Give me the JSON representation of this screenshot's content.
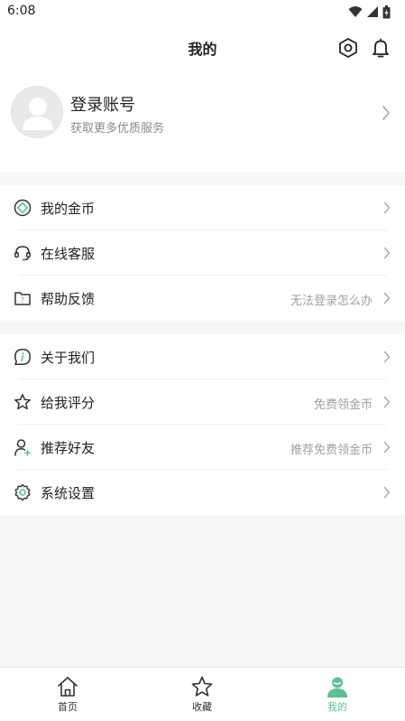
{
  "status_bar": {
    "time": "6:08"
  },
  "header": {
    "title": "我的",
    "icons": [
      "settings-hex-icon",
      "bell-icon"
    ]
  },
  "profile": {
    "title": "登录账号",
    "subtitle": "获取更多优质服务"
  },
  "menu_groups": [
    [
      {
        "id": "coins",
        "label": "我的金币",
        "icon": "coin-icon",
        "extra": ""
      },
      {
        "id": "support",
        "label": "在线客服",
        "icon": "headset-icon",
        "extra": ""
      },
      {
        "id": "feedback",
        "label": "帮助反馈",
        "icon": "help-folder-icon",
        "extra": "无法登录怎么办"
      }
    ],
    [
      {
        "id": "about",
        "label": "关于我们",
        "icon": "info-icon",
        "extra": ""
      },
      {
        "id": "rate",
        "label": "给我评分",
        "icon": "star-icon",
        "extra": "免费领金币"
      },
      {
        "id": "refer",
        "label": "推荐好友",
        "icon": "add-user-icon",
        "extra": "推荐免费领金币"
      },
      {
        "id": "settings",
        "label": "系统设置",
        "icon": "gear-icon",
        "extra": ""
      }
    ]
  ],
  "tabs": [
    {
      "label": "首页",
      "icon": "home-icon",
      "active": false
    },
    {
      "label": "收藏",
      "icon": "star-icon",
      "active": false
    },
    {
      "label": "我的",
      "icon": "person-icon",
      "active": true
    }
  ],
  "colors": {
    "accent": "#5fbf94",
    "text": "#222222",
    "muted": "#8a8a8a",
    "background": "#f7f7f7"
  }
}
